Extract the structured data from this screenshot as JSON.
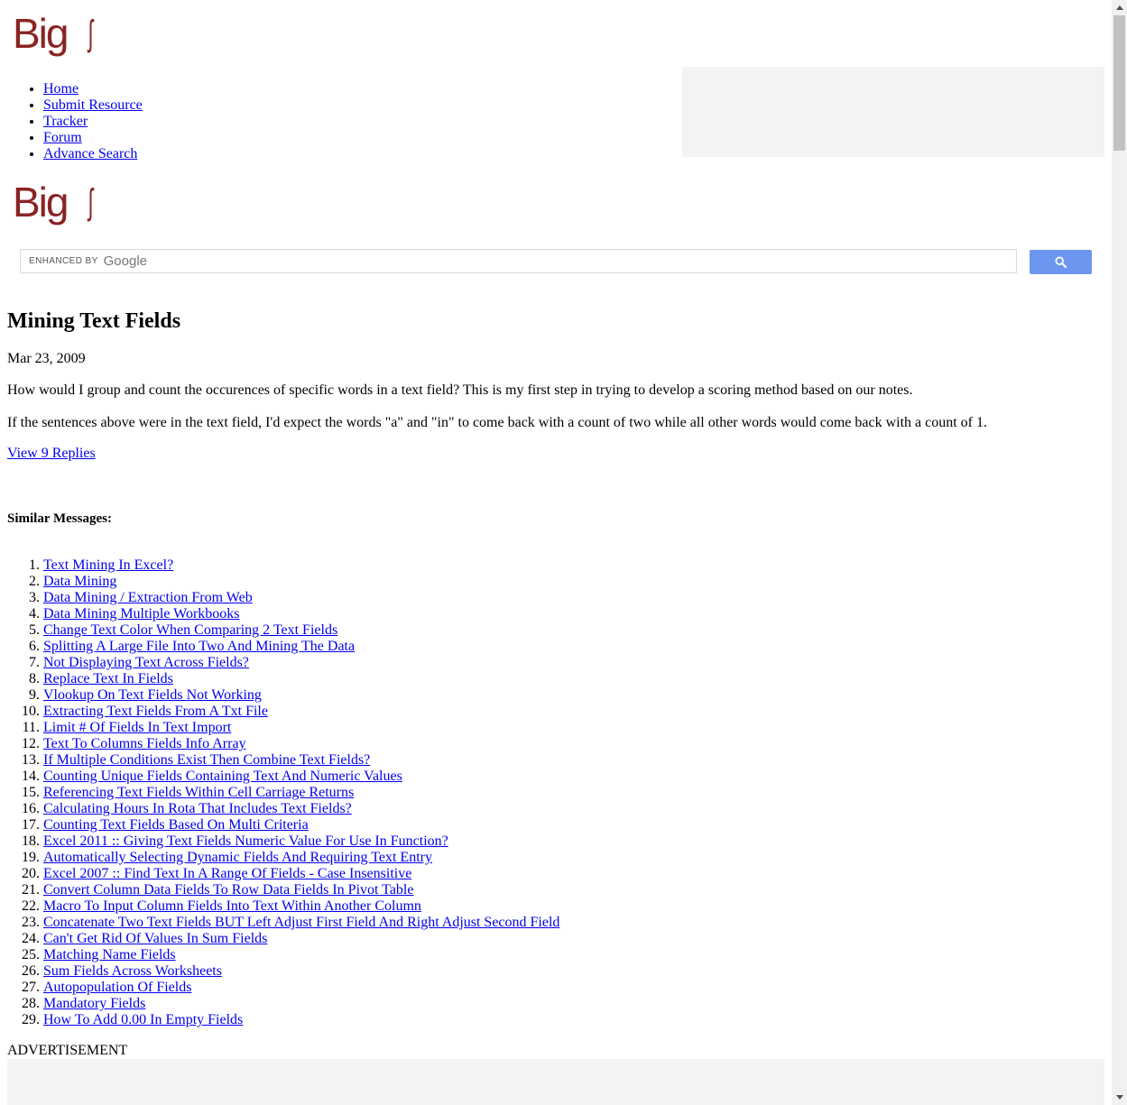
{
  "colors": {
    "logo": "#8b2323",
    "link": "#0000ee",
    "ad_placeholder": "#f3f3f3",
    "search_button": "#6d96f1",
    "scrollbar_track": "#f1f1f1",
    "scrollbar_thumb": "#c1c1c1"
  },
  "logo": {
    "text": "Big",
    "mark": "ʃ"
  },
  "nav": {
    "items": [
      {
        "label": "Home"
      },
      {
        "label": "Submit Resource"
      },
      {
        "label": "Tracker"
      },
      {
        "label": "Forum"
      },
      {
        "label": "Advance Search"
      }
    ]
  },
  "search": {
    "enhanced_by": "ENHANCED BY",
    "brand": "Google",
    "button_icon": "search-icon"
  },
  "post": {
    "title": "Mining Text Fields",
    "date": "Mar 23, 2009",
    "paragraphs": [
      "How would I group and count the occurences of specific words in a text field? This is my first step in trying to develop a scoring method based on our notes.",
      "If the sentences above were in the text field, I'd expect the words \"a\" and \"in\" to come back with a count of two while all other words would come back with a count of 1."
    ],
    "replies_link": "View 9 Replies"
  },
  "similar": {
    "heading": "Similar Messages:",
    "items": [
      "Text Mining In Excel?",
      "Data Mining",
      "Data Mining / Extraction From Web",
      "Data Mining Multiple Workbooks",
      "Change Text Color When Comparing 2 Text Fields",
      "Splitting A Large File Into Two And Mining The Data",
      "Not Displaying Text Across Fields?",
      "Replace Text In Fields",
      "Vlookup On Text Fields Not Working",
      "Extracting Text Fields From A Txt File",
      "Limit # Of Fields In Text Import",
      "Text To Columns Fields Info Array",
      "If Multiple Conditions Exist Then Combine Text Fields?",
      "Counting Unique Fields Containing Text And Numeric Values",
      "Referencing Text Fields Within Cell Carriage Returns",
      "Calculating Hours In Rota That Includes Text Fields?",
      "Counting Text Fields Based On Multi Criteria",
      "Excel 2011 :: Giving Text Fields Numeric Value For Use In Function?",
      "Automatically Selecting Dynamic Fields And Requiring Text Entry",
      "Excel 2007 :: Find Text In A Range Of Fields - Case Insensitive",
      "Convert Column Data Fields To Row Data Fields In Pivot Table",
      "Macro To Input Column Fields Into Text Within Another Column",
      "Concatenate Two Text Fields BUT Left Adjust First Field And Right Adjust Second Field",
      "Can't Get Rid Of Values In Sum Fields",
      "Matching Name Fields",
      "Sum Fields Across Worksheets",
      "Autopopulation Of Fields",
      "Mandatory Fields",
      "How To Add 0.00 In Empty Fields"
    ]
  },
  "advertisement_label": "ADVERTISEMENT"
}
